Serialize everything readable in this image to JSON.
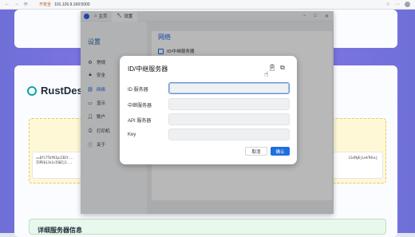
{
  "browser": {
    "back": "←",
    "forward": "→",
    "reload": "⟳",
    "security_label": "不安全",
    "url": "101.126.9.169:5000"
  },
  "webpage": {
    "brand": "RustDesk",
    "key_line1": "==Qfi7TbfKIpiID2t...",
    "key_line2": "I5PEb1Jn1sIS0Zj1...",
    "key_right1": "LSsMyEjLekTHioj",
    "details_title": "详细服务器信息"
  },
  "app": {
    "tabs": [
      {
        "label": "主页"
      },
      {
        "label": "设置"
      }
    ],
    "sidebar_title": "设置",
    "sidebar_items": [
      {
        "label": "常规",
        "icon": "gear-icon"
      },
      {
        "label": "安全",
        "icon": "lock-icon"
      },
      {
        "label": "网络",
        "icon": "link-icon"
      },
      {
        "label": "显示",
        "icon": "monitor-icon"
      },
      {
        "label": "账户",
        "icon": "user-icon"
      },
      {
        "label": "打印机",
        "icon": "printer-icon"
      },
      {
        "label": "关于",
        "icon": "info-icon"
      }
    ],
    "active_item": "网络",
    "content_title": "网络",
    "content_row": "ID/中继服务器"
  },
  "dialog": {
    "title": "ID/中继服务器",
    "fields": [
      {
        "label": "ID 服务器",
        "value": ""
      },
      {
        "label": "中继服务器",
        "value": ""
      },
      {
        "label": "API 服务器",
        "value": ""
      },
      {
        "label": "Key",
        "value": ""
      }
    ],
    "cancel_label": "取消",
    "ok_label": "确认"
  },
  "colors": {
    "accent": "#1e6fe0",
    "page_gradient": "#7b73e0"
  }
}
